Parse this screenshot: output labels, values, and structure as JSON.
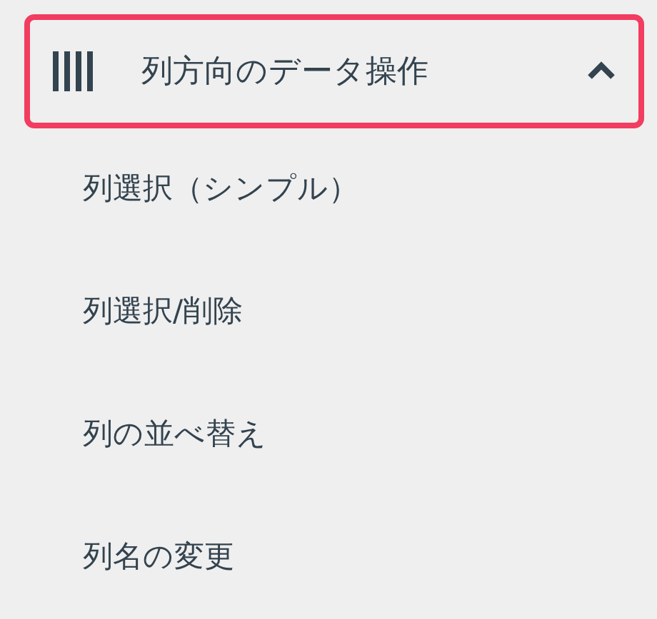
{
  "section": {
    "title": "列方向のデータ操作",
    "expanded": true,
    "focused": true
  },
  "items": [
    {
      "label": "列選択（シンプル）"
    },
    {
      "label": "列選択/削除"
    },
    {
      "label": "列の並べ替え"
    },
    {
      "label": "列名の変更"
    }
  ]
}
